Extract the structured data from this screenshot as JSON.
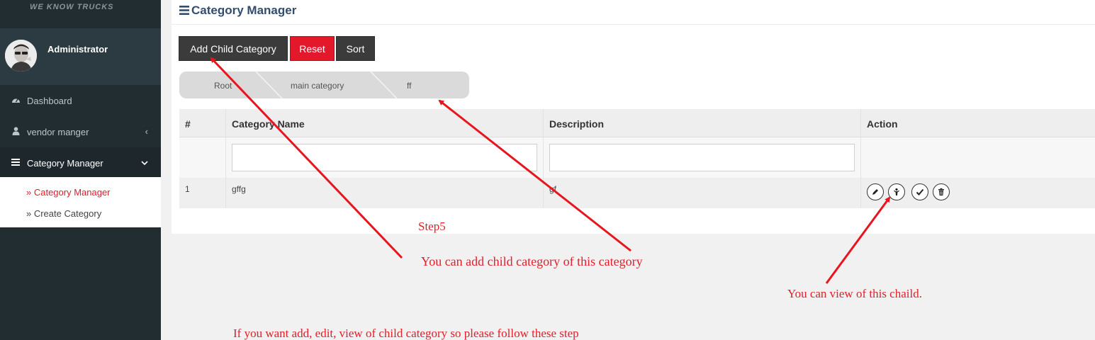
{
  "brand": {
    "tagline": "WE KNOW TRUCKS"
  },
  "user": {
    "name": "Administrator"
  },
  "sidebar": {
    "items": [
      {
        "label": "Dashboard",
        "icon": "dashboard-icon"
      },
      {
        "label": "vendor manger",
        "icon": "user-icon",
        "caret": "‹"
      },
      {
        "label": "Category Manager",
        "icon": "bars-icon",
        "caret": "⌄"
      }
    ],
    "submenu": [
      {
        "label": "» Category Manager",
        "active": true
      },
      {
        "label": "» Create Category",
        "active": false
      }
    ]
  },
  "page": {
    "title": "Category Manager",
    "title_icon": "bars-icon"
  },
  "toolbar": {
    "add_child_label": "Add Child Category",
    "reset_label": "Reset",
    "sort_label": "Sort"
  },
  "breadcrumb": [
    "Root",
    "main category",
    "ff"
  ],
  "table": {
    "headers": [
      "#",
      "Category Name",
      "Description",
      "Action"
    ],
    "filters": {
      "name": "",
      "description": ""
    },
    "rows": [
      {
        "num": "1",
        "name": "gffg",
        "description": "gf"
      }
    ],
    "actions": [
      "edit-icon",
      "view-child-icon",
      "approve-icon",
      "delete-icon"
    ]
  },
  "annotations": {
    "step": "Step5",
    "add_child": "You can add child category of this category",
    "view_child": "You can view of this chaild.",
    "instructions": "If you want add, edit, view of child category so please follow these step"
  },
  "colors": {
    "accent_red": "#e3192b",
    "annotation_red": "#e0202b",
    "sidebar_bg": "#222d32",
    "title_blue": "#324d6e"
  }
}
